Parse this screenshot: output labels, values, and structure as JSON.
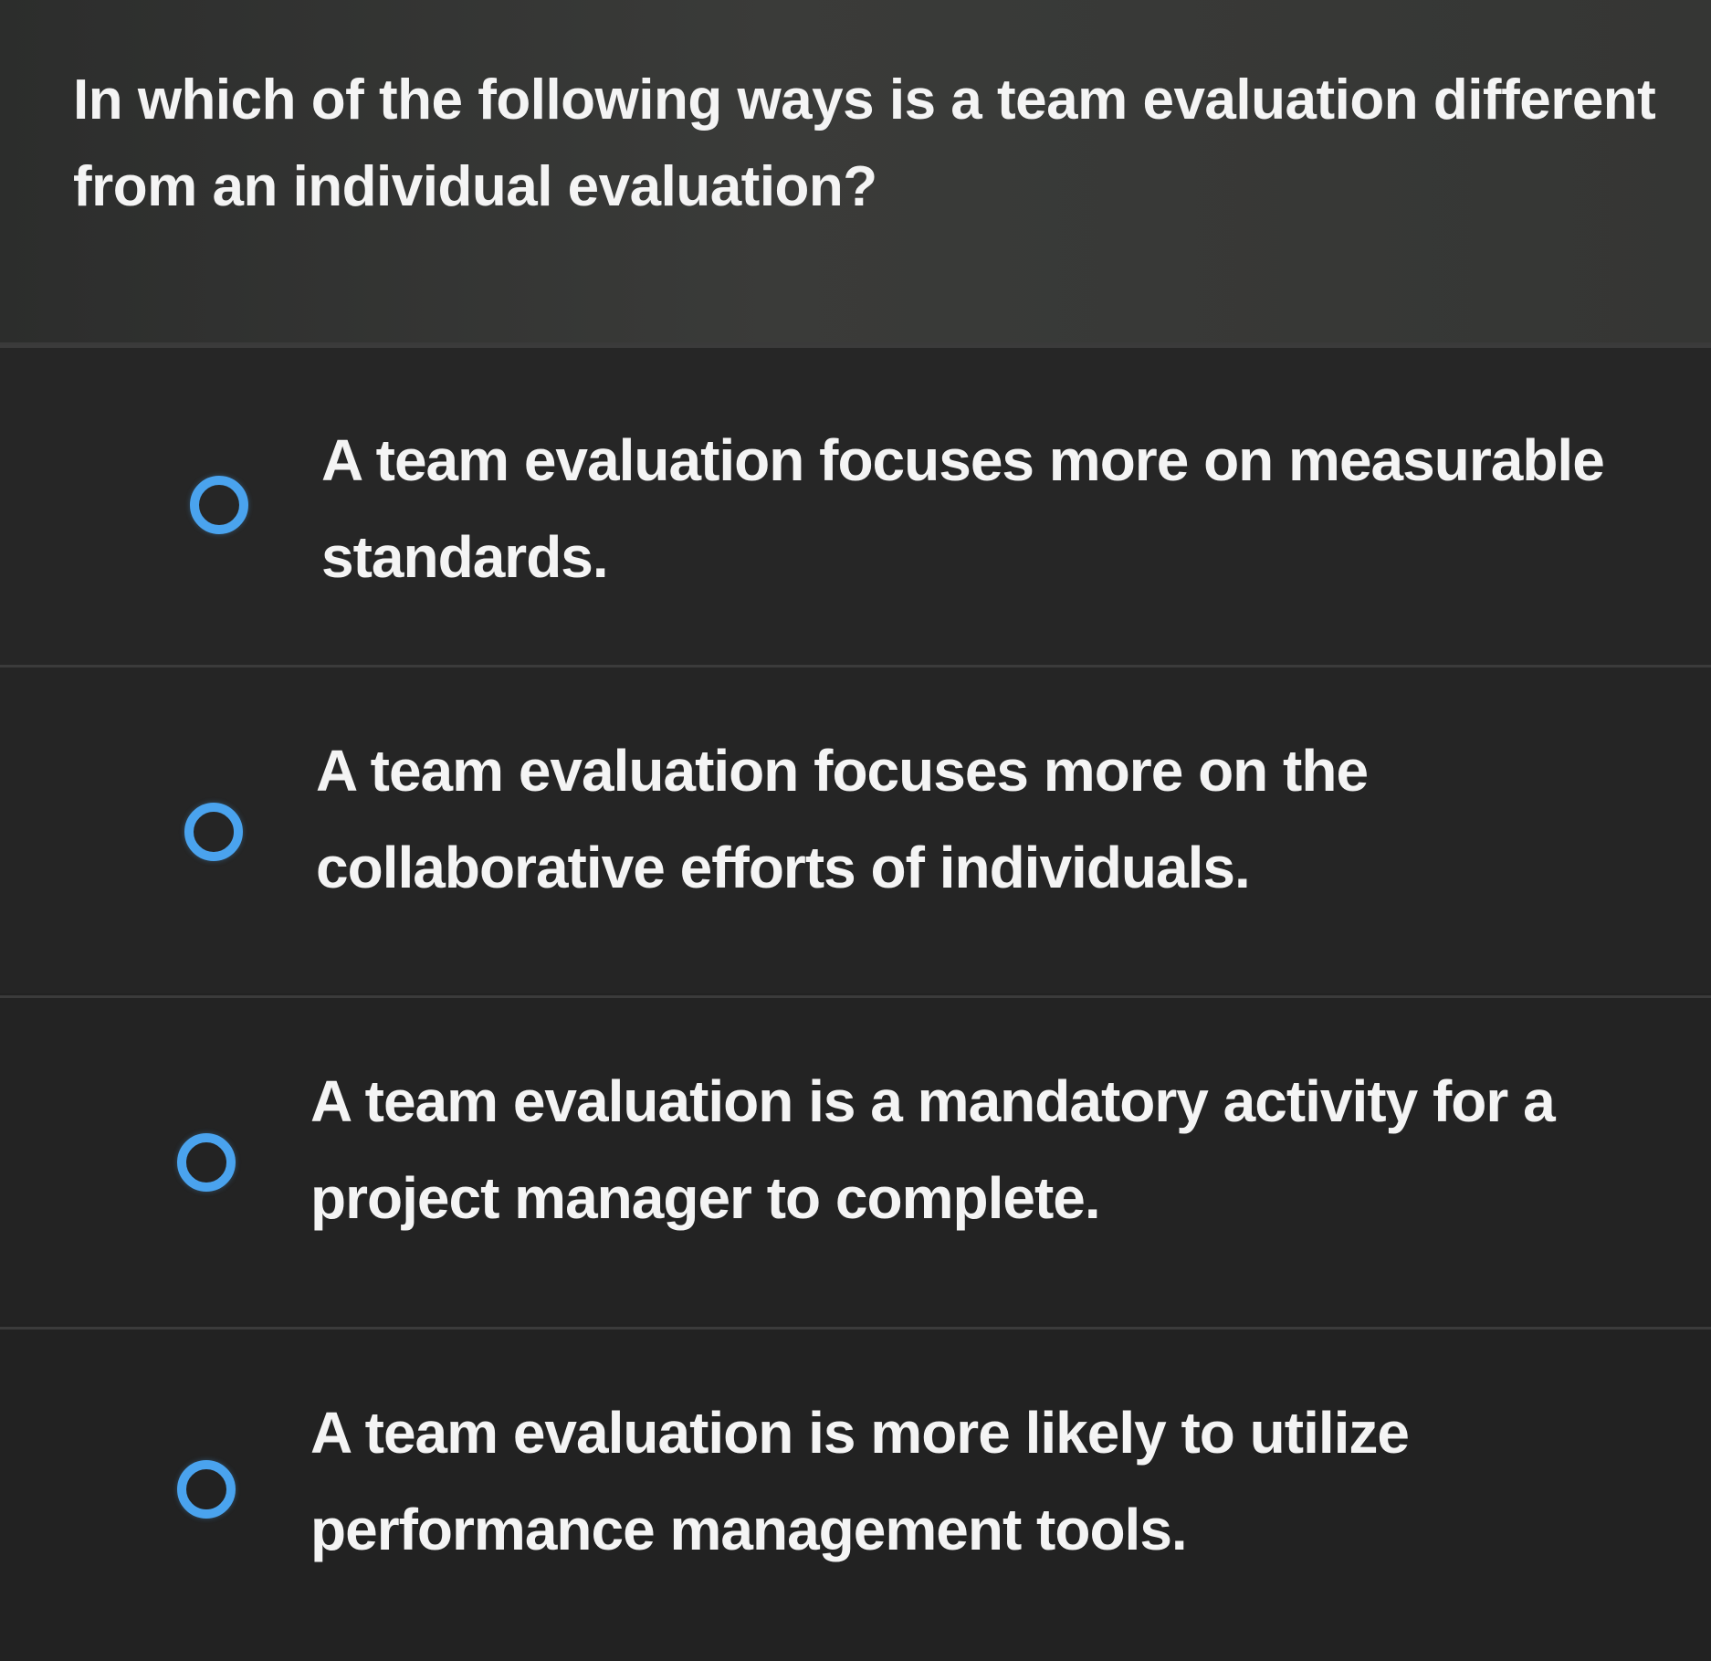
{
  "question": {
    "text": "In which of the following ways is a team evaluation different from an individual evaluation?"
  },
  "options": [
    {
      "label": "A team evaluation focuses more on measurable standards.",
      "selected": false
    },
    {
      "label": "A team evaluation focuses more on the collaborative efforts of individuals.",
      "selected": false
    },
    {
      "label": "A team evaluation is a mandatory activity for a project manager to complete.",
      "selected": false
    },
    {
      "label": "A team evaluation is more likely to utilize performance management tools.",
      "selected": false
    }
  ],
  "colors": {
    "radio_accent": "#4aa3ee",
    "background": "#222222",
    "text": "#f4f4f4"
  }
}
